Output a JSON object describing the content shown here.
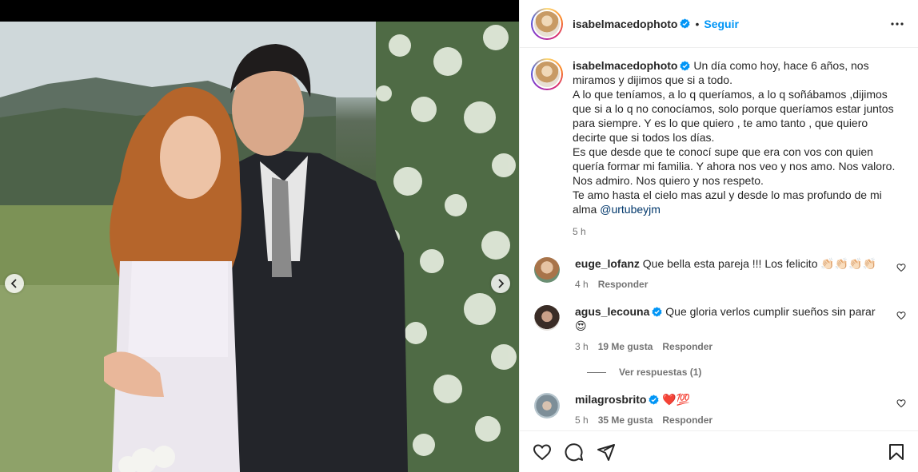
{
  "post": {
    "username": "isabelmacedophoto",
    "separator": "•",
    "follow_label": "Seguir"
  },
  "caption": {
    "username": "isabelmacedophoto",
    "text": "Un día como hoy, hace 6 años, nos miramos y dijimos que si a todo. A lo que teníamos, a lo q queríamos, a lo q soñábamos ,dijimos que si a lo q no conocíamos, solo porque queríamos estar juntos para siempre. Y es lo que quiero , te amo tanto , que quiero decirte que si todos los días. Es que desde que te conocí supe que era con vos con quien quería formar mi familia. Y ahora nos veo y nos amo. Nos valoro. Nos admiro. Nos quiero y nos respeto. Te amo hasta el cielo mas azul y desde lo mas profundo de mi alma",
    "lines": [
      "Un día como hoy, hace 6 años, nos",
      "miramos y dijimos que si a todo.",
      "A lo que teníamos, a lo q queríamos, a lo q soñábamos ,dijimos",
      "que si a lo q no conocíamos, solo porque queríamos estar juntos",
      "para siempre. Y es lo que quiero , te amo tanto , que quiero",
      "decirte que si todos los días.",
      "Es que desde que te conocí supe que era con vos con quien",
      "quería formar mi familia. Y ahora nos veo y nos amo. Nos valoro.",
      "Nos admiro. Nos quiero y nos respeto.",
      "Te amo hasta el cielo mas azul y desde lo mas profundo de mi",
      "alma "
    ],
    "mention": "@urtubeyjm",
    "time": "5 h"
  },
  "comments": [
    {
      "username": "euge_lofanz",
      "verified": false,
      "text": "Que bella esta pareja !!! Los felicito 👏🏻👏🏻👏🏻👏🏻",
      "time": "4 h",
      "likes": "",
      "reply_label": "Responder",
      "avatar_color": "#c9a27a"
    },
    {
      "username": "agus_lecouna",
      "verified": true,
      "text": "Que gloria verlos cumplir sueños sin parar 😍",
      "time": "3 h",
      "likes": "19 Me gusta",
      "reply_label": "Responder",
      "avatar_color": "#4a3a32"
    },
    {
      "username": "milagrosbrito",
      "verified": true,
      "text": "❤️💯",
      "time": "5 h",
      "likes": "35 Me gusta",
      "reply_label": "Responder",
      "avatar_color": "#8fa3b0"
    }
  ],
  "view_replies_label": "Ver respuestas (1)",
  "icons": {
    "verified_color": "#0095f6",
    "link_color": "#00376b",
    "follow_color": "#0095f6",
    "muted_color": "#737373"
  }
}
